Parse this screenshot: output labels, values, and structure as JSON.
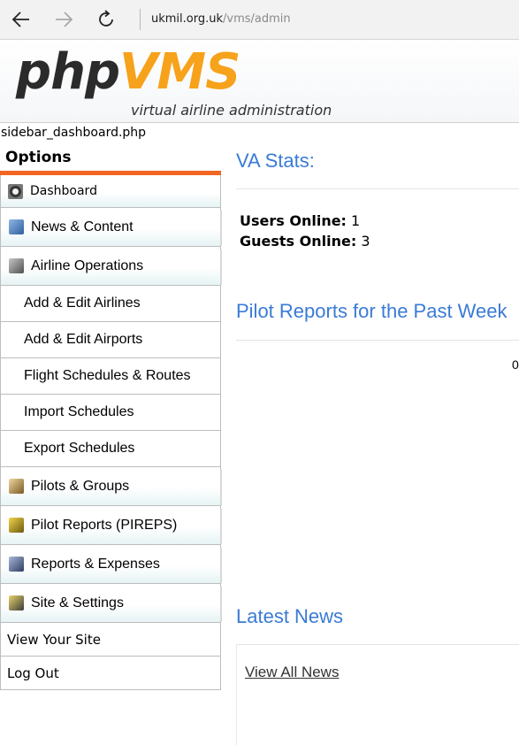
{
  "browser": {
    "url_domain": "ukmil.org.uk",
    "url_path": "/vms/admin"
  },
  "header": {
    "logo_php": "php",
    "logo_vms": "VMS",
    "logo_tagline": "virtual airline administration"
  },
  "sidebar": {
    "file_label": "sidebar_dashboard.php",
    "options_title": "Options",
    "accent_color": "#f26522",
    "items": [
      {
        "label": "Dashboard",
        "icon": "dashboard-icon"
      },
      {
        "label": "News & Content",
        "icon": "news-icon"
      },
      {
        "label": "Airline Operations",
        "icon": "airline-icon"
      },
      {
        "label": "Add & Edit Airlines"
      },
      {
        "label": "Add & Edit Airports"
      },
      {
        "label": "Flight Schedules & Routes"
      },
      {
        "label": "Import Schedules"
      },
      {
        "label": "Export Schedules"
      },
      {
        "label": "Pilots & Groups",
        "icon": "pilots-icon"
      },
      {
        "label": "Pilot Reports (PIREPS)",
        "icon": "pireps-icon"
      },
      {
        "label": "Reports & Expenses",
        "icon": "reports-icon"
      },
      {
        "label": "Site & Settings",
        "icon": "settings-icon"
      },
      {
        "label": "View Your Site"
      },
      {
        "label": "Log Out"
      }
    ]
  },
  "main": {
    "va_stats_title": "VA Stats:",
    "users_online_label": "Users Online:",
    "users_online_value": "1",
    "guests_online_label": "Guests Online:",
    "guests_online_value": "3",
    "pilot_reports_title": "Pilot Reports for the Past Week",
    "chart_value": "0",
    "latest_news_title": "Latest News",
    "view_all_news": "View All News",
    "title_color": "#3a7bd5"
  }
}
